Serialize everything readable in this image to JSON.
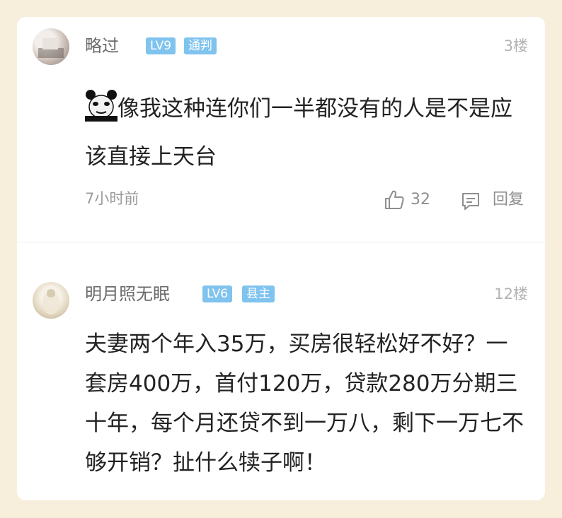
{
  "comments": [
    {
      "username": "略过",
      "level": "LV9",
      "title": "通判",
      "floor": "3楼",
      "sticker_icon": "panda-face-sticker-icon",
      "text": "像我这种连你们一半都没有的人是不是应该直接上天台",
      "time": "7小时前",
      "likes": "32",
      "reply_label": "回复"
    },
    {
      "username": "明月照无眠",
      "level": "LV6",
      "title": "县主",
      "floor": "12楼",
      "text": "夫妻两个年入35万，买房很轻松好不好？一套房400万，首付120万，贷款280万分期三十年，每个月还贷不到一万八，剩下一万七不够开销？扯什么犊子啊！"
    }
  ],
  "colors": {
    "background": "#f7efdb",
    "card": "#ffffff",
    "badge": "#7fc3ee"
  }
}
